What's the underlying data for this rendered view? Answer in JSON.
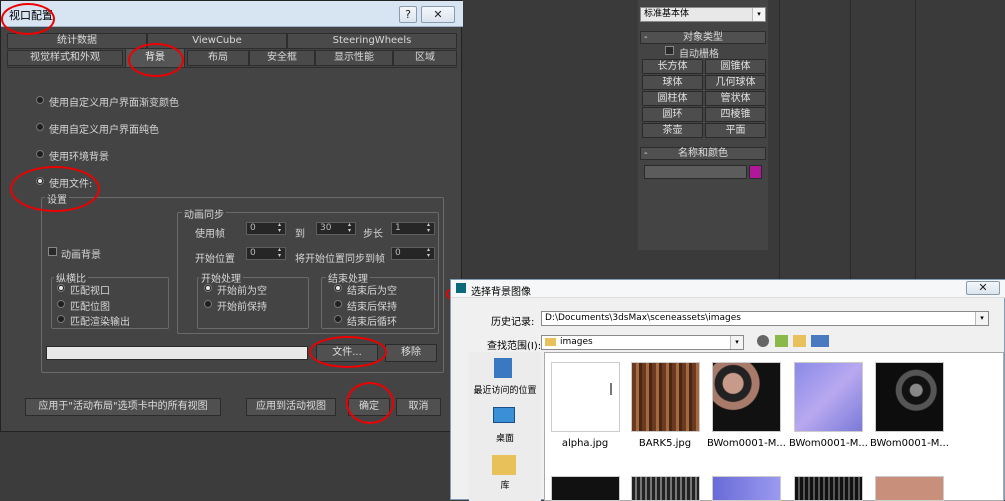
{
  "viewport_dialog": {
    "title": "视口配置",
    "help_btn": "?",
    "close_btn": "✕",
    "tabs_row1": [
      "统计数据",
      "ViewCube",
      "SteeringWheels"
    ],
    "tabs_row2": [
      "视觉样式和外观",
      "背景",
      "布局",
      "安全框",
      "显示性能",
      "区域"
    ],
    "radios": [
      "使用自定义用户界面渐变颜色",
      "使用自定义用户界面纯色",
      "使用环境背景",
      "使用文件:"
    ],
    "settings_label": "设置",
    "anim_sync": "动画同步",
    "use_frame": "使用帧",
    "use_frame_from": "0",
    "to": "到",
    "use_frame_to": "30",
    "step": "步长",
    "step_val": "1",
    "start_at": "开始位置",
    "start_at_val": "0",
    "sync_start": "将开始位置同步到帧",
    "sync_start_val": "0",
    "animate_bg": "动画背景",
    "aspect": "纵横比",
    "aspect_opts": [
      "匹配视口",
      "匹配位图",
      "匹配渲染输出"
    ],
    "start_proc": "开始处理",
    "start_opts": [
      "开始前为空",
      "开始前保持"
    ],
    "end_proc": "结束处理",
    "end_opts": [
      "结束后为空",
      "结束后保持",
      "结束后循环"
    ],
    "files_btn": "文件...",
    "remove_btn": "移除",
    "apply_all_btn": "应用于\"活动布局\"选项卡中的所有视图",
    "apply_active_btn": "应用到活动视图",
    "ok_btn": "确定",
    "cancel_btn": "取消"
  },
  "right_panel": {
    "dropdown": "标准基本体",
    "object_type": "对象类型",
    "autogrid": "自动栅格",
    "objects": [
      "长方体",
      "圆锥体",
      "球体",
      "几何球体",
      "圆柱体",
      "管状体",
      "圆环",
      "四棱锥",
      "茶壶",
      "平面"
    ],
    "name_color": "名称和颜色",
    "minus": "-",
    "color_swatch": "#b0189a"
  },
  "file_dialog": {
    "title": "选择背景图像",
    "close_btn": "✕",
    "history_label": "历史记录:",
    "history_value": "D:\\Documents\\3dsMax\\sceneassets\\images",
    "lookin_label": "查找范围(I):",
    "lookin_value": "images",
    "places": [
      "最近访问的位置",
      "桌面",
      "库"
    ],
    "files": [
      "alpha.jpg",
      "BARK5.jpg",
      "BWom0001-M...",
      "BWom0001-M...",
      "BWom0001-M..."
    ]
  }
}
